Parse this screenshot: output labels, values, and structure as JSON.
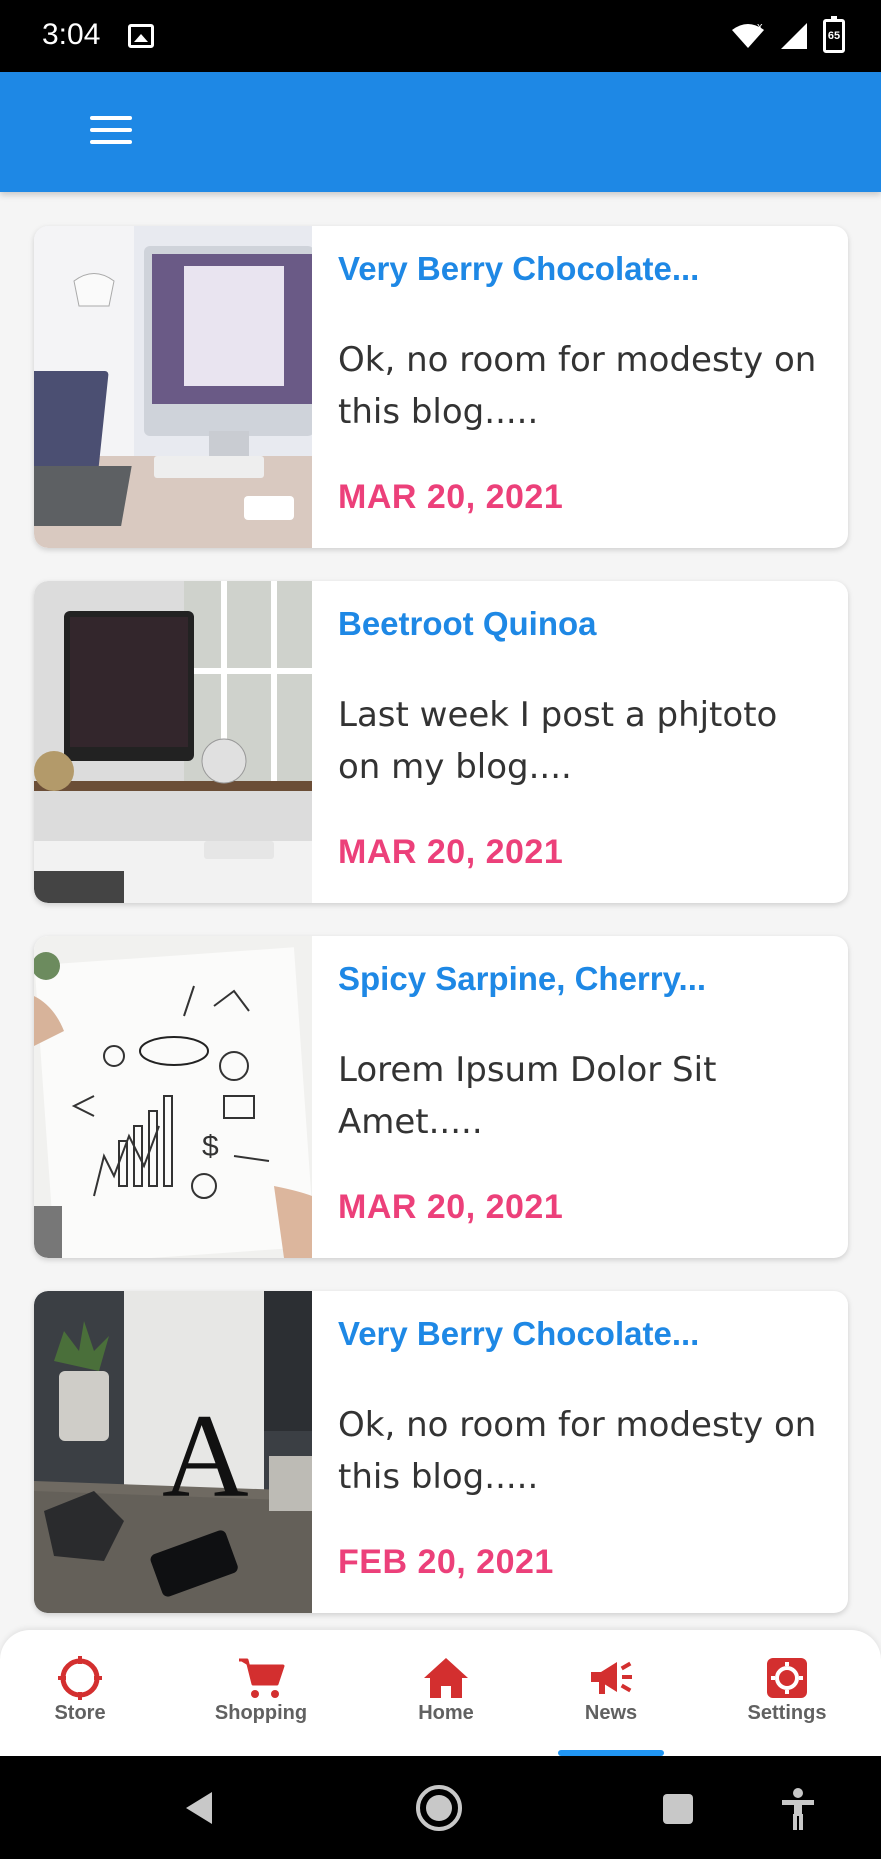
{
  "status_bar": {
    "time": "3:04",
    "battery": "65"
  },
  "colors": {
    "app_bar": "#1e88e5",
    "title": "#1e88e5",
    "date": "#ec407a",
    "nav_icon": "#d32f2f",
    "indicator": "#2196f3"
  },
  "posts": [
    {
      "title": "Very Berry Chocolate...",
      "excerpt": "Ok, no room for modesty on this blog.....",
      "date": "MAR 20, 2021",
      "image": "desk-imac-laptop"
    },
    {
      "title": "Beetroot Quinoa",
      "excerpt": "Last week I post a phjtoto on my blog....",
      "date": "MAR 20, 2021",
      "image": "desk-imac-window"
    },
    {
      "title": "Spicy Sarpine, Cherry...",
      "excerpt": "Lorem Ipsum Dolor Sit Amet.....",
      "date": "MAR 20, 2021",
      "image": "business-sketch"
    },
    {
      "title": "Very Berry Chocolate...",
      "excerpt": "Ok, no room for modesty on this blog.....",
      "date": "FEB 20, 2021",
      "image": "letter-a-desk"
    }
  ],
  "bottom_nav": [
    {
      "label": "Store",
      "icon": "crosshair-icon"
    },
    {
      "label": "Shopping",
      "icon": "cart-icon"
    },
    {
      "label": "Home",
      "icon": "home-icon"
    },
    {
      "label": "News",
      "icon": "megaphone-icon",
      "active": true
    },
    {
      "label": "Settings",
      "icon": "gear-icon"
    }
  ]
}
